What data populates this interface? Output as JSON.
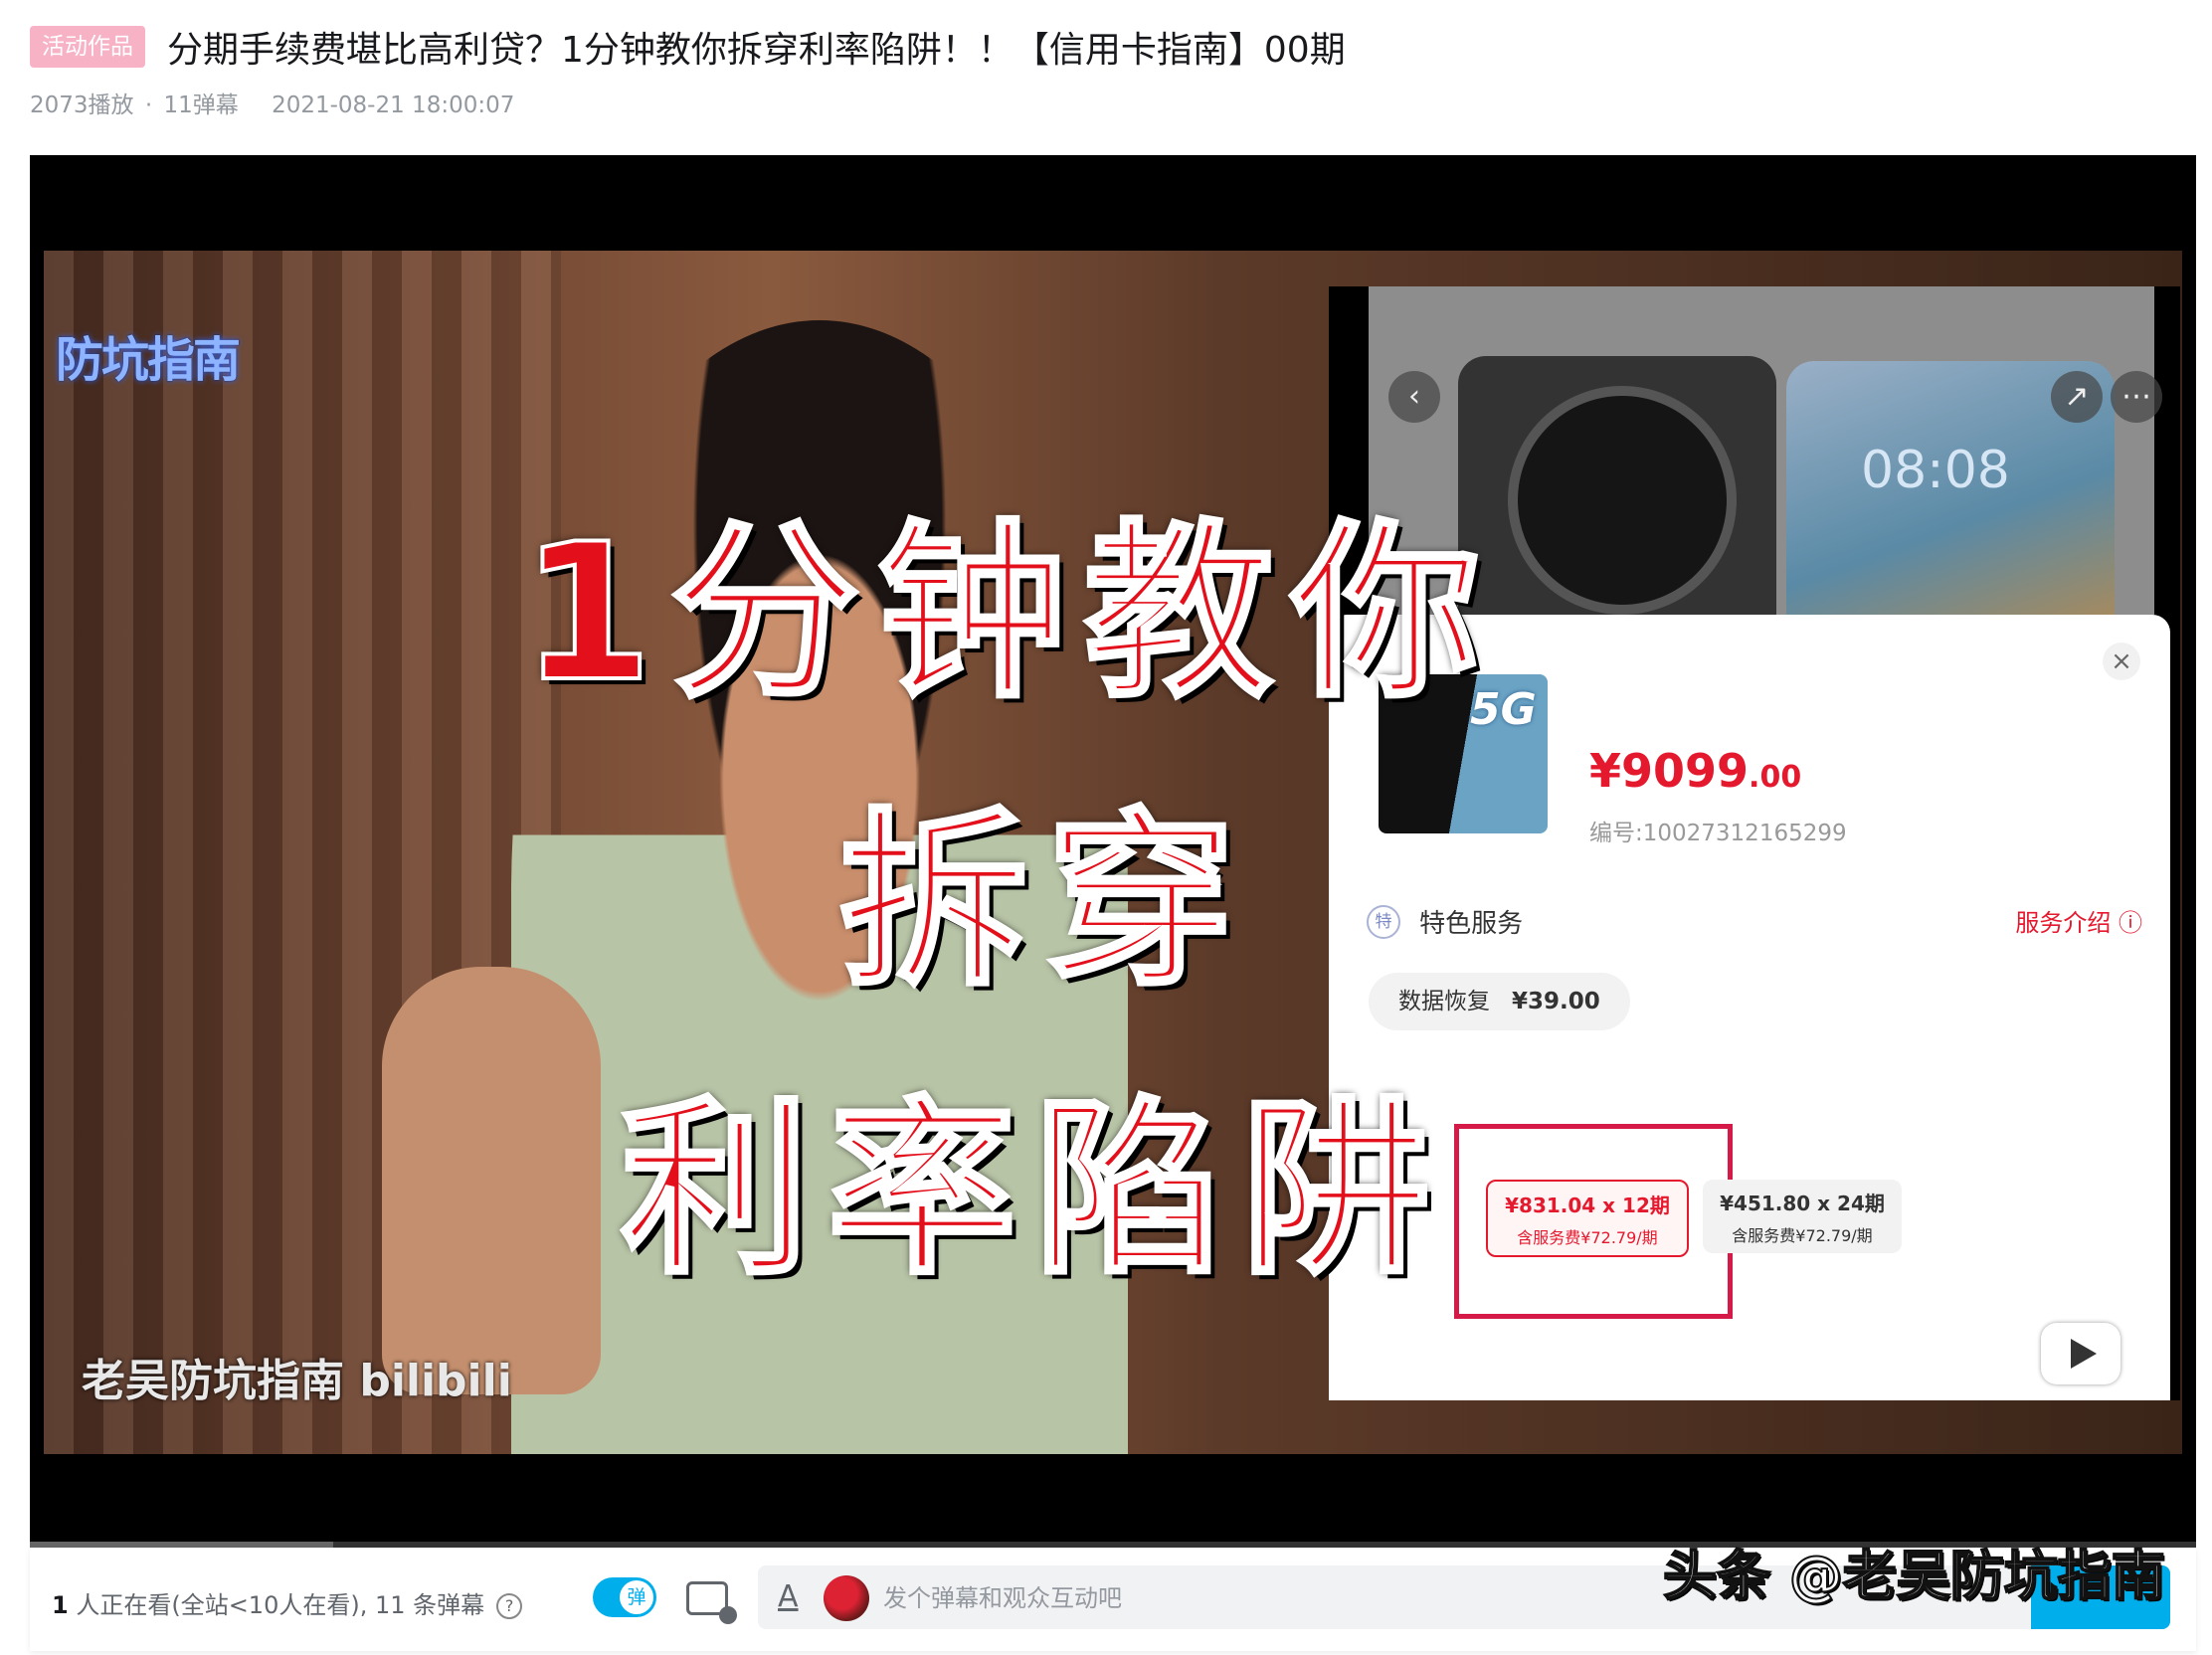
{
  "header": {
    "tag": "活动作品",
    "title": "分期手续费堪比高利贷？1分钟教你拆穿利率陷阱！！【信用卡指南】00期",
    "plays": "2073播放",
    "dot": "·",
    "danmaku_count": "11弹幕",
    "date": "2021-08-21 18:00:07"
  },
  "video": {
    "badge": "防坑指南",
    "line1": "1分钟教你",
    "line2": "拆穿",
    "line3": "利率陷阱",
    "watermark": "老吴防坑指南 bilibili",
    "inset": {
      "clock": "08:08",
      "product_badge": "5G",
      "price_main": "¥9099",
      "price_decimal": ".00",
      "sku": "编号:10027312165299",
      "service_icon": "特",
      "service_title": "特色服务",
      "service_link": "服务介绍 ⓘ",
      "chip_label": "数据恢复",
      "chip_price": "¥39.00",
      "plan_a_line1": "¥831.04 x 12期",
      "plan_a_line2": "含服务费¥72.79/期",
      "plan_b_line1": "¥451.80 x 24期",
      "plan_b_line2": "含服务费¥72.79/期",
      "close": "×"
    },
    "progress": 0.14
  },
  "controls": {
    "viewers_num": "1",
    "viewers_text": " 人正在看(全站<10人在看), 11 条弹幕",
    "help": "?",
    "toggle_label": "弹",
    "font_icon": "A",
    "placeholder": "发个弹幕和观众互动吧"
  },
  "corner_watermark": "头条 @老吴防坑指南",
  "colors": {
    "accent": "#00aeec",
    "price_red": "#e5192e",
    "tag_pink": "#f7b2c6"
  }
}
